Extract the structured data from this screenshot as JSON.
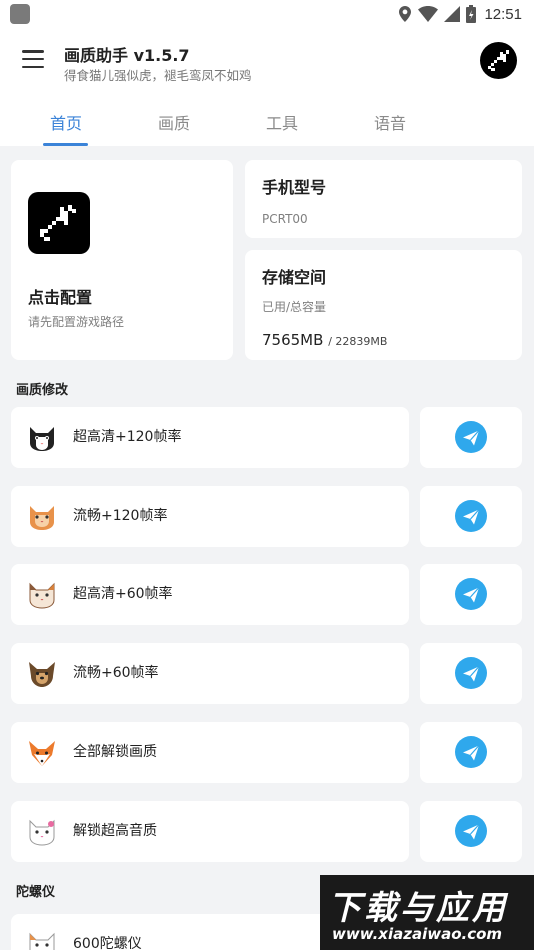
{
  "status_bar": {
    "time": "12:51",
    "icons": [
      "app-notification-icon",
      "location-icon",
      "wifi-icon",
      "signal-icon",
      "battery-icon"
    ]
  },
  "app_bar": {
    "title": "画质助手 v1.5.7",
    "subtitle": "得食猫儿强似虎，褪毛鸾凤不如鸡"
  },
  "tabs": [
    {
      "label": "首页",
      "active": true
    },
    {
      "label": "画质",
      "active": false
    },
    {
      "label": "工具",
      "active": false
    },
    {
      "label": "语音",
      "active": false
    }
  ],
  "config_card": {
    "title": "点击配置",
    "subtitle": "请先配置游戏路径"
  },
  "phone_card": {
    "title": "手机型号",
    "value": "PCRT00"
  },
  "storage_card": {
    "title": "存储空间",
    "subtitle": "已用/总容量",
    "used": "7565MB",
    "total": "/ 22839MB"
  },
  "sections": {
    "quality": "画质修改",
    "gyro": "陀螺仪"
  },
  "quality_items": [
    {
      "label": "超高清+120帧率",
      "icon": "tuxedo-cat-icon"
    },
    {
      "label": "流畅+120帧率",
      "icon": "orange-cat-icon"
    },
    {
      "label": "超高清+60帧率",
      "icon": "calico-cat-icon"
    },
    {
      "label": "流畅+60帧率",
      "icon": "dog-icon"
    },
    {
      "label": "全部解锁画质",
      "icon": "fox-icon"
    },
    {
      "label": "解锁超高音质",
      "icon": "white-cat-icon"
    }
  ],
  "gyro_items": [
    {
      "label": "600陀螺仪",
      "icon": "cat-icon"
    }
  ],
  "watermark": {
    "title": "下载与应用",
    "url": "www.xiazaiwao.com"
  },
  "colors": {
    "accent": "#3b83d8",
    "send": "#2fa8ec",
    "background": "#f2f3f5"
  }
}
